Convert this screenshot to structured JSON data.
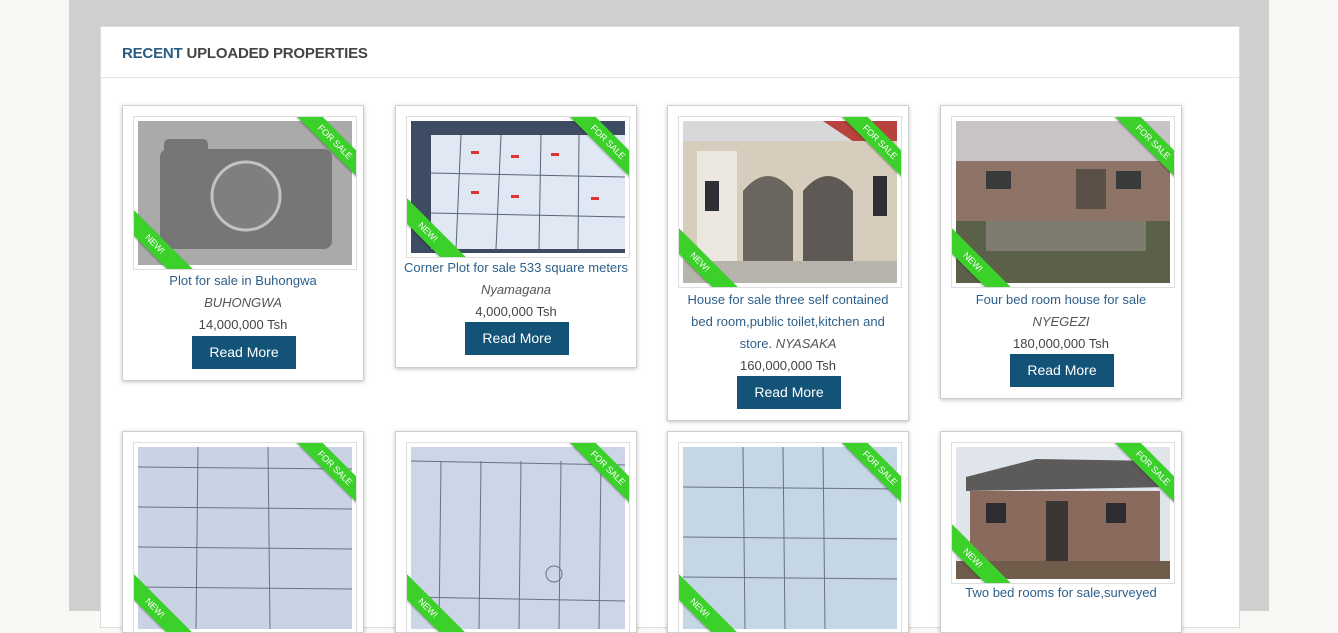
{
  "panel": {
    "heading_accent": "RECENT",
    "heading_rest": " UPLOADED PROPERTIES"
  },
  "ribbons": {
    "sale": "FOR SALE",
    "new": "NEW!"
  },
  "cards": [
    {
      "title": "Plot for sale in Buhongwa",
      "location": "BUHONGWA",
      "price": "14,000,000 Tsh",
      "button": "Read More",
      "image": "camera-placeholder"
    },
    {
      "title": "Corner Plot for sale 533 square meters",
      "location": "Nyamagana",
      "price": "4,000,000 Tsh",
      "button": "Read More",
      "image": "plot-map-photo"
    },
    {
      "title": "House for sale three self contained bed room,public toilet,kitchen and store.",
      "location": "NYASAKA",
      "price": "160,000,000 Tsh",
      "button": "Read More",
      "image": "house-photo"
    },
    {
      "title": "Four bed room house for sale",
      "location": "NYEGEZI",
      "price": "180,000,000 Tsh",
      "button": "Read More",
      "image": "house-photo"
    },
    {
      "image": "survey-map-photo"
    },
    {
      "image": "survey-map-photo"
    },
    {
      "image": "survey-map-photo"
    },
    {
      "title": "Two bed rooms for sale,surveyed",
      "image": "house-photo"
    }
  ]
}
